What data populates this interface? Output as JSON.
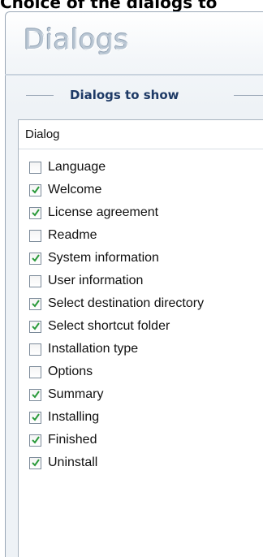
{
  "top_caption": "Choice of the dialogs to",
  "panel": {
    "title": "Dialogs"
  },
  "group": {
    "legend": "Dialogs to show"
  },
  "list": {
    "header": "Dialog",
    "items": [
      {
        "label": "Language",
        "checked": false
      },
      {
        "label": "Welcome",
        "checked": true
      },
      {
        "label": "License agreement",
        "checked": true
      },
      {
        "label": "Readme",
        "checked": false
      },
      {
        "label": "System information",
        "checked": true
      },
      {
        "label": "User information",
        "checked": false
      },
      {
        "label": "Select destination directory",
        "checked": true
      },
      {
        "label": "Select shortcut folder",
        "checked": true
      },
      {
        "label": "Installation type",
        "checked": false
      },
      {
        "label": "Options",
        "checked": false
      },
      {
        "label": "Summary",
        "checked": true
      },
      {
        "label": "Installing",
        "checked": true
      },
      {
        "label": "Finished",
        "checked": true
      },
      {
        "label": "Uninstall",
        "checked": true
      }
    ]
  },
  "colors": {
    "checkmark": "#2a9a3a",
    "legend": "#1e3a66",
    "panel_border": "#9aa7b6"
  }
}
